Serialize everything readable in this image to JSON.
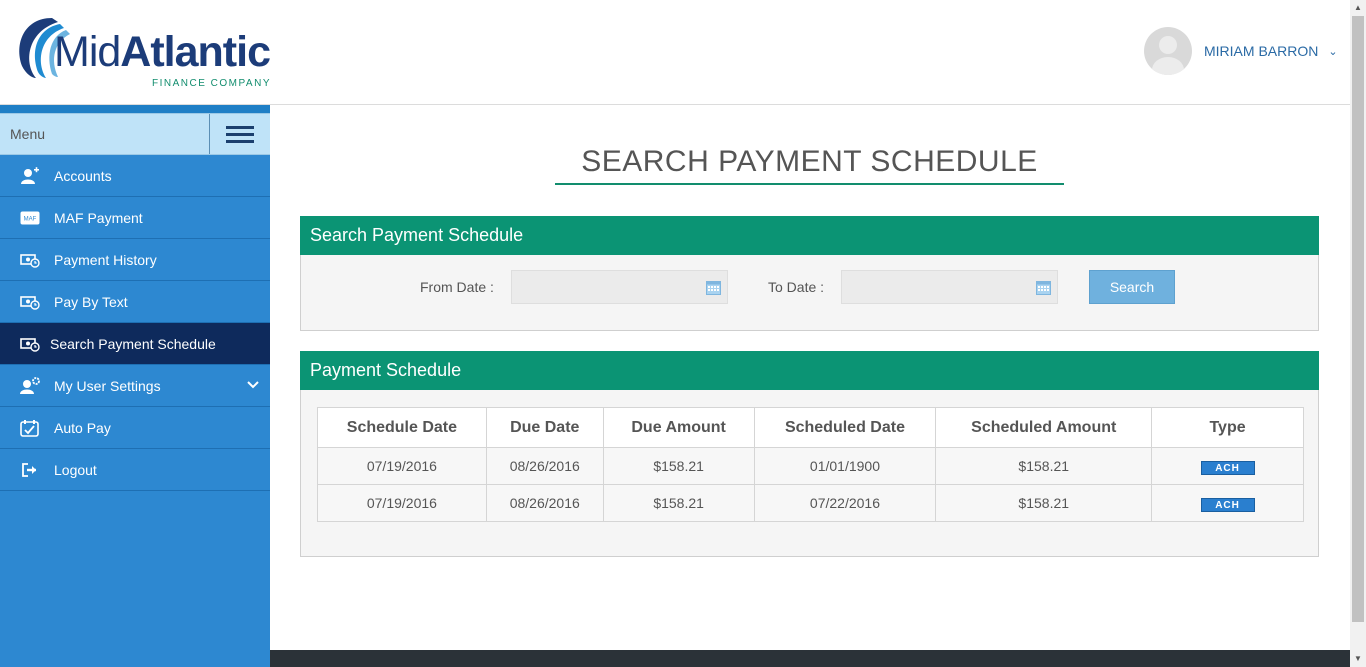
{
  "brand": {
    "name_prefix": "Mid",
    "name_suffix": "Atlantic",
    "tagline": "FINANCE COMPANY"
  },
  "header": {
    "user_name": "MIRIAM BARRON"
  },
  "sidebar": {
    "menu_label": "Menu",
    "items": [
      {
        "label": "Accounts",
        "icon": "user-add-icon"
      },
      {
        "label": "MAF Payment",
        "icon": "maf-card-icon",
        "icon_text": "MAF"
      },
      {
        "label": "Payment History",
        "icon": "money-clock-icon"
      },
      {
        "label": "Pay By Text",
        "icon": "money-clock-icon"
      },
      {
        "label": "Search Payment Schedule",
        "icon": "money-clock-icon",
        "active": true
      },
      {
        "label": "My User Settings",
        "icon": "user-settings-icon",
        "has_submenu": true
      },
      {
        "label": "Auto Pay",
        "icon": "calendar-check-icon"
      },
      {
        "label": "Logout",
        "icon": "logout-icon"
      }
    ]
  },
  "main": {
    "page_title": "SEARCH PAYMENT SCHEDULE",
    "search_panel": {
      "title": "Search Payment Schedule",
      "from_label": "From Date :",
      "from_value": "",
      "to_label": "To Date :",
      "to_value": "",
      "search_button": "Search"
    },
    "schedule_panel": {
      "title": "Payment Schedule",
      "columns": [
        "Schedule Date",
        "Due Date",
        "Due Amount",
        "Scheduled Date",
        "Scheduled Amount",
        "Type"
      ],
      "rows": [
        [
          "07/19/2016",
          "08/26/2016",
          "$158.21",
          "01/01/1900",
          "$158.21",
          "ACH"
        ],
        [
          "07/19/2016",
          "08/26/2016",
          "$158.21",
          "07/22/2016",
          "$158.21",
          "ACH"
        ]
      ]
    }
  },
  "colors": {
    "accent_green": "#0b9474",
    "sidebar_blue": "#2d88d1",
    "active_navy": "#0e2a5c"
  }
}
